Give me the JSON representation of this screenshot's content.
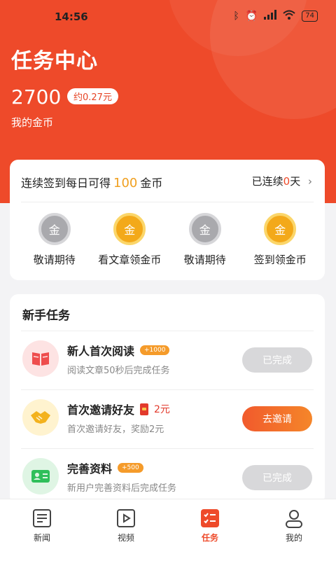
{
  "status": {
    "time": "14:56",
    "battery": "74"
  },
  "header": {
    "title": "任务中心",
    "coins": "2700",
    "yuan_value": "约0.27元",
    "coin_label": "我的金币"
  },
  "signin": {
    "text_prefix": "连续签到每日可得",
    "amount": "100",
    "text_suffix": "金币",
    "streak_prefix": "已连续",
    "streak_days": "0",
    "streak_suffix": "天",
    "medal_char": "金",
    "items": [
      {
        "label": "敬请期待",
        "style": "grey"
      },
      {
        "label": "看文章领金币",
        "style": "gold"
      },
      {
        "label": "敬请期待",
        "style": "grey"
      },
      {
        "label": "签到领金币",
        "style": "gold"
      }
    ]
  },
  "tasks": {
    "heading": "新手任务",
    "items": [
      {
        "title": "新人首次阅读",
        "badge": "+1000",
        "desc": "阅读文章50秒后完成任务",
        "button": "已完成",
        "icon": "book-icon",
        "icon_bg": "#fde3e3"
      },
      {
        "title": "首次邀请好友",
        "reward": "2元",
        "desc": "首次邀请好友，奖励2元",
        "button": "去邀请",
        "icon": "handshake-icon",
        "icon_bg": "#fff3cf"
      },
      {
        "title": "完善资料",
        "badge": "+500",
        "desc": "新用户完善资料后完成任务",
        "button": "已完成",
        "icon": "id-card-icon",
        "icon_bg": "#dff5e4"
      }
    ]
  },
  "tabbar": {
    "items": [
      {
        "label": "新闻",
        "icon": "news-icon"
      },
      {
        "label": "视频",
        "icon": "video-icon"
      },
      {
        "label": "任务",
        "icon": "task-icon",
        "active": true
      },
      {
        "label": "我的",
        "icon": "profile-icon"
      }
    ]
  },
  "colors": {
    "brand": "#ee4a2a",
    "gold": "#f3a91a",
    "done": "#d8d8da"
  }
}
